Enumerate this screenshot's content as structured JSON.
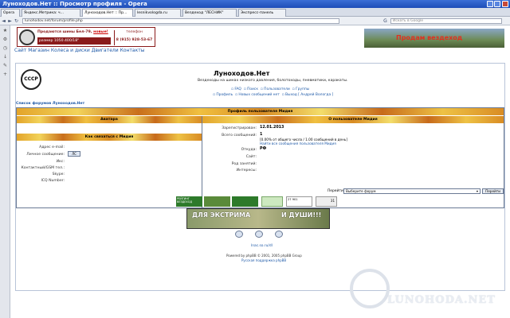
{
  "window": {
    "title": "Луноходов.Нет :: Просмотр профиля - Opera"
  },
  "tabs": [
    {
      "label": "Opera"
    },
    {
      "label": "Яндекс.Метрика: ч..."
    },
    {
      "label": "Луноходов.Нет :: Пр..."
    },
    {
      "label": "lesnikvologda.ru"
    },
    {
      "label": "Вездеход \"ЛЕСНИК\""
    },
    {
      "label": "Экспресс-панель"
    }
  ],
  "nav": {
    "back": "◄",
    "forward": "►",
    "reload": "↻",
    "home": "⌂",
    "address": "lunohodov.net/forum/profile.php",
    "search_placeholder": "Искать в Google"
  },
  "banner": {
    "line1": "Продаются шины Бел-79,",
    "new": "новые!",
    "size": "размер 1050.400/18\"",
    "phone_label": "телефон",
    "phone": "8 (915) 928-53-67",
    "right": "Продам вездеход"
  },
  "topnav": {
    "site": "Сайт",
    "shop": "Магазин",
    "wheels": "Колеса и диски",
    "engines": "Двигатели",
    "contacts": "Контакты"
  },
  "header": {
    "emblem": "СССР",
    "title": "Луноходов.Нет",
    "subtitle": "Вездеходы на шинах низкого давления, болотоходы, пневматики, каракаты.",
    "faq": "FAQ",
    "search": "Поиск",
    "users": "Пользователи",
    "groups": "Группы",
    "profile": "Профиль",
    "pm": "Новых сообщений нет",
    "logout": "Выход [ Андрей Вологда ]"
  },
  "breadcrumb": "Список форумов Луноходов.Нет",
  "profile": {
    "header": "Профиль пользователя Мидия",
    "avatar": "Аватара",
    "about": "О пользователе Мидия",
    "registered_label": "Зарегистрирован:",
    "registered": "12.01.2013",
    "posts_label": "Всего сообщений:",
    "posts": "1",
    "posts_stats": "[0.00% от общего числа / 1.00 сообщений в день]",
    "posts_find": "Найти все сообщения пользователя Мидия",
    "from_label": "Откуда:",
    "from": "РФ",
    "site_label": "Сайт:",
    "occupation_label": "Род занятий:",
    "interests_label": "Интересы:",
    "contact": "Как связаться с Мидия",
    "email_label": "Адрес e-mail:",
    "pm_label": "Личное сообщение:",
    "pm_button": "ЛС",
    "icq_label": "Икс:",
    "jabber_label": "Контактный/GSM тел.:",
    "skype_label": "Skype:",
    "icqnum_label": "ICQ Number:"
  },
  "jump": {
    "label": "Перейти:",
    "option": "Выберите форум",
    "button": "Перейти"
  },
  "promo": {
    "left": "ДЛЯ ЭКСТРИМА",
    "right": "И ДУШИ!!!"
  },
  "footer": {
    "link": "lnac.so.ru/dl",
    "powered": "Powered by phpBB © 2001, 2005 phpBB Group",
    "support": "Русская поддержка phpBB"
  },
  "counters": [
    "РЕЙТИНГ ВЕЗДЕХОД",
    "27 901",
    "31"
  ],
  "watermark": "LUNOHODA.NET"
}
